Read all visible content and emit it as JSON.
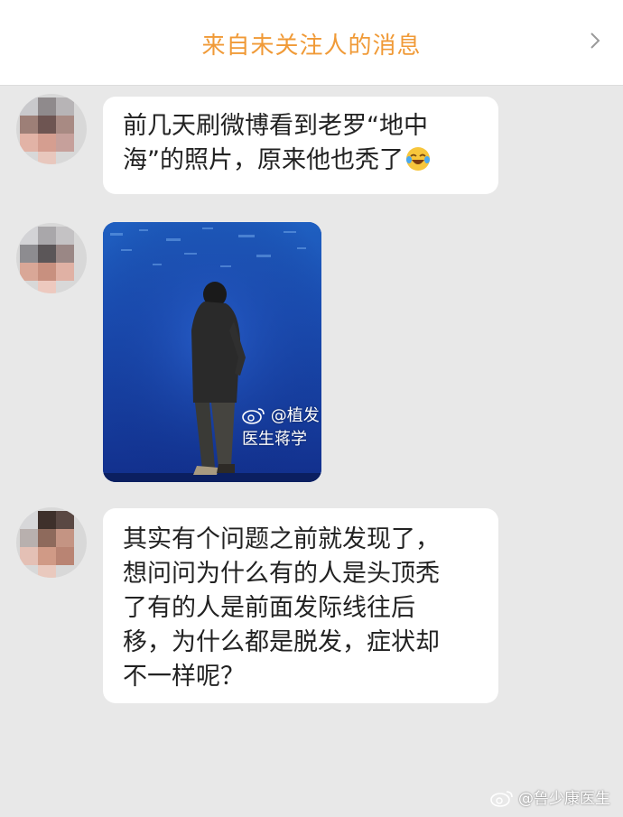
{
  "header": {
    "title": "来自未关注人的消息"
  },
  "messages": [
    {
      "type": "text",
      "lines": [
        "前几天刷微博看到老罗“地中",
        "海”的照片，原来他也秃了"
      ],
      "emoji": "laugh-cry-emoji"
    },
    {
      "type": "image",
      "watermark": "@植发医生蒋学"
    },
    {
      "type": "text",
      "lines": [
        "其实有个问题之前就发现了，",
        "想问问为什么有的人是头顶秃",
        "了有的人是前面发际线往后",
        "移，为什么都是脱发，症状却",
        "不一样呢？"
      ]
    }
  ],
  "page_watermark": "@鲁少康医生",
  "colors": {
    "accent": "#f09a37",
    "background": "#e8e8e8",
    "bubble": "#ffffff"
  }
}
